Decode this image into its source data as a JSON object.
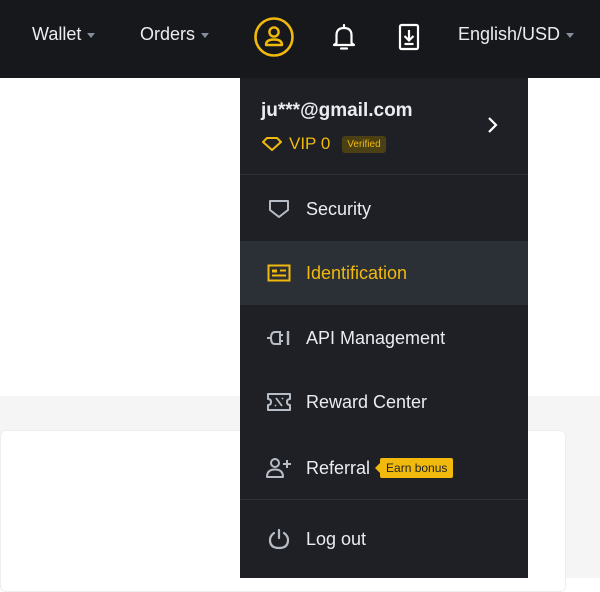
{
  "header": {
    "wallet_label": "Wallet",
    "orders_label": "Orders",
    "language_label": "English/USD"
  },
  "profile": {
    "email": "ju***@gmail.com",
    "vip_level": "VIP 0",
    "verified_badge": "Verified"
  },
  "menu": {
    "items": [
      {
        "label": "Security",
        "icon": "shield-icon"
      },
      {
        "label": "Identification",
        "icon": "id-card-icon",
        "active": true
      },
      {
        "label": "API Management",
        "icon": "api-plug-icon"
      },
      {
        "label": "Reward Center",
        "icon": "ticket-icon"
      },
      {
        "label": "Referral",
        "icon": "add-user-icon",
        "badge": "Earn bonus"
      },
      {
        "label": "Log out",
        "icon": "power-icon"
      }
    ]
  },
  "colors": {
    "accent": "#f0b90b",
    "header_bg": "#16181c",
    "dropdown_bg": "#1e2026",
    "active_bg": "#2b2f36",
    "text": "#eaecef"
  }
}
